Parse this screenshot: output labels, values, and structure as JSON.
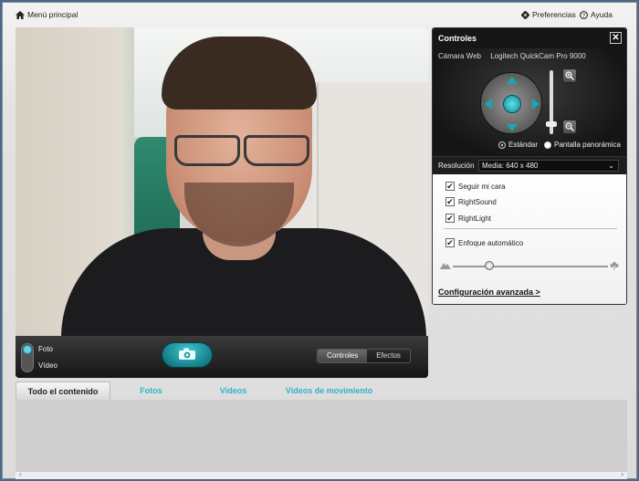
{
  "topbar": {
    "home_label": "Menú principal",
    "prefs_label": "Preferencias",
    "help_label": "Ayuda"
  },
  "capture": {
    "mode_photo": "Foto",
    "mode_video": "Vídeo",
    "tab_controls": "Controles",
    "tab_effects": "Efectos"
  },
  "panel": {
    "title": "Controles",
    "close": "✕",
    "camera_label": "Cámara Web",
    "camera_name": "Logitech QuickCam Pro 9000",
    "view_standard": "Estándar",
    "view_wide": "Pantalla panorámica",
    "resolution_label": "Resolución",
    "resolution_value": "Media: 640 x 480",
    "options": [
      {
        "label": "Seguir mi cara",
        "checked": true
      },
      {
        "label": "RightSound",
        "checked": true
      },
      {
        "label": "RightLight",
        "checked": true
      }
    ],
    "autofocus_label": "Enfoque automático",
    "advanced_link": "Configuración avanzada >"
  },
  "gallery_tabs": [
    "Todo el contenido",
    "Fotos",
    "Vídeos",
    "Vídeos de movimiento"
  ],
  "colors": {
    "accent": "#31b4c8",
    "joystick": "#138c98"
  }
}
